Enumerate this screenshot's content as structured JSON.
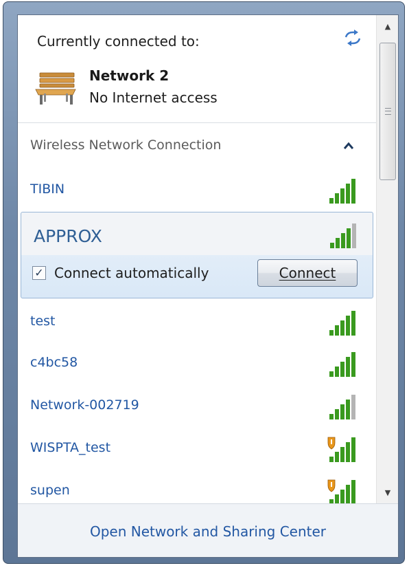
{
  "header": {
    "currently_connected_label": "Currently connected to:",
    "network_name": "Network  2",
    "network_status": "No Internet access"
  },
  "section": {
    "title": "Wireless Network Connection"
  },
  "selected_network": {
    "name": "APPROX",
    "connect_automatically_label": "Connect automatically",
    "connect_automatically_checked": true,
    "connect_button_label": "Connect",
    "signal_bars": 4
  },
  "networks": [
    {
      "name": "TIBIN",
      "signal_bars": 5,
      "secured_warning": false
    },
    {
      "name": "test",
      "signal_bars": 5,
      "secured_warning": false
    },
    {
      "name": "c4bc58",
      "signal_bars": 5,
      "secured_warning": false
    },
    {
      "name": "Network-002719",
      "signal_bars": 4,
      "secured_warning": false
    },
    {
      "name": "WISPTA_test",
      "signal_bars": 5,
      "secured_warning": true
    },
    {
      "name": "supen",
      "signal_bars": 5,
      "secured_warning": true
    }
  ],
  "footer": {
    "link_label": "Open Network and Sharing Center"
  },
  "colors": {
    "link_blue": "#2257a3",
    "signal_green": "#3a9a1f",
    "signal_gray": "#b4b4b4",
    "warning_orange": "#e8961b"
  },
  "icons": {
    "refresh": "refresh-arrows-icon",
    "bench": "bench-network-icon",
    "collapse": "chevron-up-icon",
    "signal": "signal-strength-icon",
    "warning": "security-warning-shield-icon"
  }
}
